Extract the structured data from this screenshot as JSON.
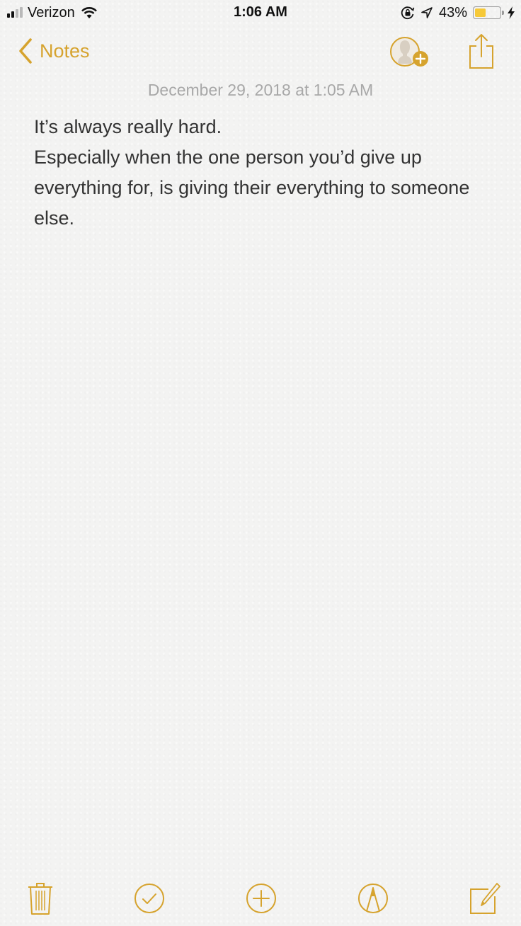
{
  "status_bar": {
    "carrier": "Verizon",
    "signal_bars_active": 2,
    "signal_bars_total": 4,
    "time": "1:06 AM",
    "battery_percent_label": "43%",
    "battery_level": 0.43,
    "icons": [
      "wifi-icon",
      "orientation-lock-icon",
      "location-icon",
      "battery-icon",
      "charging-icon"
    ]
  },
  "nav": {
    "back_label": "Notes",
    "actions": [
      "add-people",
      "share"
    ]
  },
  "note": {
    "date": "December 29, 2018 at 1:05 AM",
    "lines": [
      "It’s always really hard.",
      "Especially when the one person you’d give up everything for, is giving their everything to someone else."
    ]
  },
  "toolbar": {
    "items": [
      "delete",
      "checklist",
      "add",
      "markup",
      "compose"
    ]
  },
  "colors": {
    "accent": "#d6a32e",
    "text": "#333333",
    "date_text": "#a8a8a8",
    "battery_fill": "#f6c938",
    "background": "#f3f3f2"
  }
}
